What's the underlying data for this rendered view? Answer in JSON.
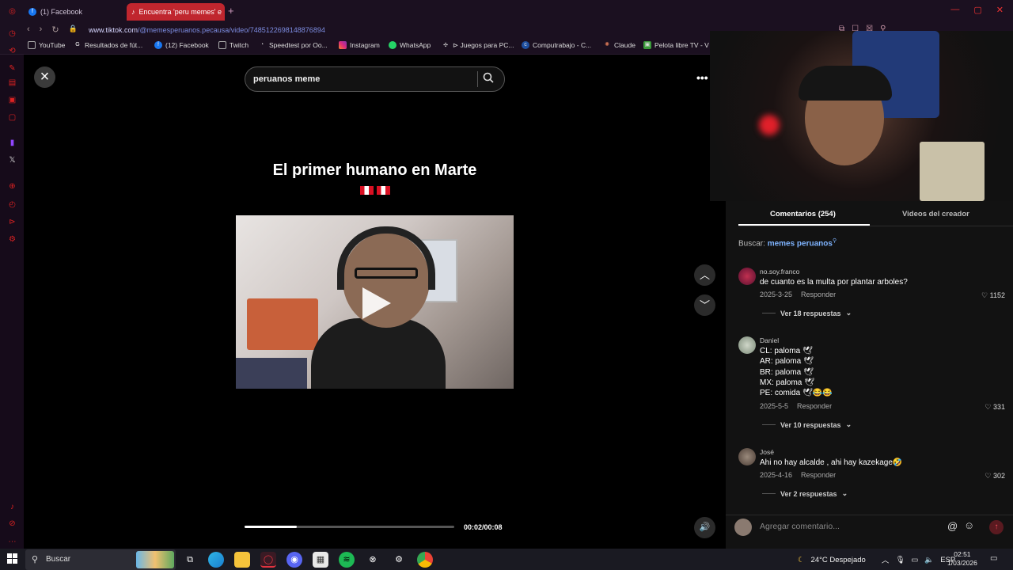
{
  "browser": {
    "tabs": [
      {
        "label": "(1) Facebook",
        "icon": "facebook-icon"
      },
      {
        "label": "Encuentra 'peru memes' e",
        "icon": "tiktok-icon"
      }
    ],
    "new_tab": "+",
    "url_domain": "www.tiktok.com",
    "url_path": "/@memesperuanos.pecausa/video/7485122698148876894",
    "bookmarks": [
      {
        "label": "YouTube",
        "icon": "youtube-icon"
      },
      {
        "label": "Resultados de fút...",
        "icon": "google-icon"
      },
      {
        "label": "(12) Facebook",
        "icon": "facebook-icon"
      },
      {
        "label": "Twitch",
        "icon": "twitch-icon"
      },
      {
        "label": "Speedtest por Oo...",
        "icon": "speedtest-icon"
      },
      {
        "label": "Instagram",
        "icon": "instagram-icon"
      },
      {
        "label": "WhatsApp",
        "icon": "whatsapp-icon"
      },
      {
        "label": "⊳ Juegos para PC...",
        "icon": "game-icon"
      },
      {
        "label": "Computrabajo - C...",
        "icon": "computrabajo-icon"
      },
      {
        "label": "Claude",
        "icon": "claude-icon"
      },
      {
        "label": "Pelota libre TV - V",
        "icon": "tv-icon"
      }
    ]
  },
  "player": {
    "search_value": "peruanos meme",
    "overlay_title": "El primer humano en Marte",
    "elapsed": "00:02",
    "duration": "00:08",
    "time_text": "00:02/00:08",
    "progress": 0.25
  },
  "panel": {
    "tab_comments": "Comentarios (254)",
    "tab_videos": "Videos del creador",
    "search_prefix": "Buscar:",
    "search_link": "memes peruanos",
    "comments": [
      {
        "user": "no.soy.franco",
        "lines": [
          "de cuanto es la multa por plantar arboles?"
        ],
        "date": "2025-3-25",
        "reply": "Responder",
        "likes": "1152",
        "replies": "Ver 18 respuestas"
      },
      {
        "user": "Daniel",
        "lines": [
          "CL: paloma 🕊",
          "AR: paloma 🕊",
          "BR: paloma 🕊",
          "MX: paloma 🕊",
          "PE: comida 🕊😂😂"
        ],
        "date": "2025-5-5",
        "reply": "Responder",
        "likes": "331",
        "replies": "Ver 10 respuestas"
      },
      {
        "user": "José",
        "lines": [
          "Ahi no hay alcalde , ahi hay kazekage🤣"
        ],
        "date": "2025-4-16",
        "reply": "Responder",
        "likes": "302",
        "replies": "Ver 2 respuestas"
      }
    ],
    "comment_placeholder": "Agregar comentario..."
  },
  "taskbar": {
    "search_placeholder": "Buscar",
    "weather": "24°C Despejado",
    "language": "ESP",
    "time": "02:51",
    "date": "1/03/2026"
  },
  "colors": {
    "accent": "#fe2c55",
    "link": "#7fb4ff",
    "browser_chrome": "#1b1020",
    "active_tab": "#c0262e"
  }
}
